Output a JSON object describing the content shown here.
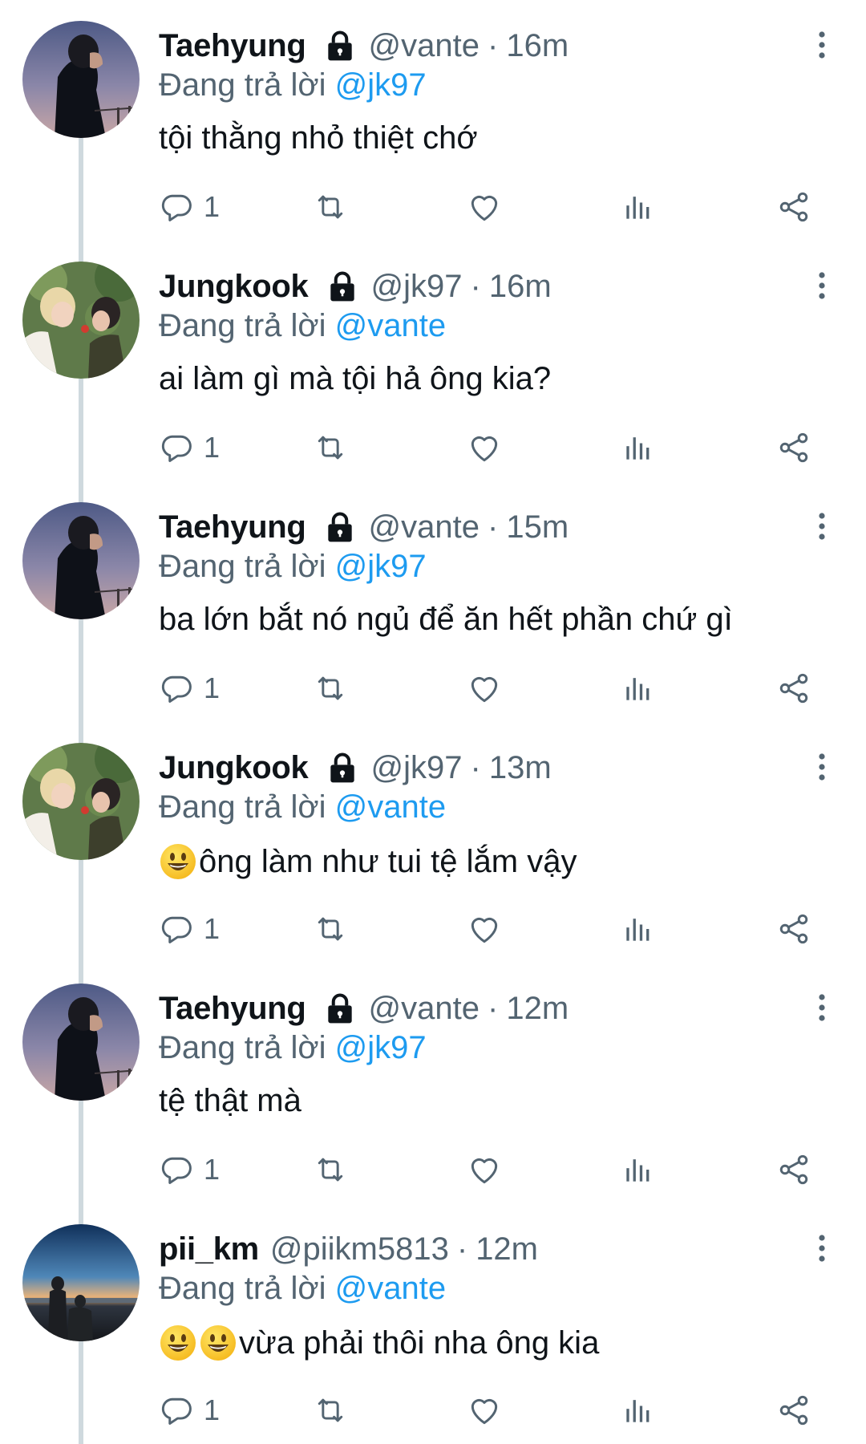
{
  "tweets": [
    {
      "name": "Taehyung",
      "protected": true,
      "handle": "@vante",
      "separator": "·",
      "time": "16m",
      "reply_prefix": "Đang trả lời ",
      "reply_to": "@jk97",
      "emoji_count": 0,
      "text": "tội thằng nhỏ thiệt chớ",
      "reply_count": "1",
      "avatar": "taehyung-avatar"
    },
    {
      "name": "Jungkook",
      "protected": true,
      "handle": "@jk97",
      "separator": "·",
      "time": "16m",
      "reply_prefix": "Đang trả lời ",
      "reply_to": "@vante",
      "emoji_count": 0,
      "text": "ai làm gì mà tội hả ông kia?",
      "reply_count": "1",
      "avatar": "jungkook-avatar"
    },
    {
      "name": "Taehyung",
      "protected": true,
      "handle": "@vante",
      "separator": "·",
      "time": "15m",
      "reply_prefix": "Đang trả lời ",
      "reply_to": "@jk97",
      "emoji_count": 0,
      "text": "ba lớn bắt nó ngủ để ăn hết phần chứ gì",
      "reply_count": "1",
      "avatar": "taehyung-avatar"
    },
    {
      "name": "Jungkook",
      "protected": true,
      "handle": "@jk97",
      "separator": "·",
      "time": "13m",
      "reply_prefix": "Đang trả lời ",
      "reply_to": "@vante",
      "emoji_count": 1,
      "text": "ông làm như tui tệ lắm vậy",
      "reply_count": "1",
      "avatar": "jungkook-avatar"
    },
    {
      "name": "Taehyung",
      "protected": true,
      "handle": "@vante",
      "separator": "·",
      "time": "12m",
      "reply_prefix": "Đang trả lời ",
      "reply_to": "@jk97",
      "emoji_count": 0,
      "text": "tệ thật mà",
      "reply_count": "1",
      "avatar": "taehyung-avatar"
    },
    {
      "name": "pii_km",
      "protected": false,
      "handle": "@piikm5813",
      "separator": "·",
      "time": "12m",
      "reply_prefix": "Đang trả lời ",
      "reply_to": "@vante",
      "emoji_count": 2,
      "text": "vừa phải thôi nha ông kia",
      "reply_count": "1",
      "avatar": "piikm-avatar"
    }
  ],
  "icons": {
    "reply": "reply-icon",
    "retweet": "retweet-icon",
    "like": "heart-icon",
    "views": "views-icon",
    "share": "share-icon",
    "more": "more-vertical-icon",
    "lock": "lock-icon",
    "emoji": "grinning-face-emoji"
  },
  "colors": {
    "text": "#0f1419",
    "secondary": "#536471",
    "mention": "#1d9bf0",
    "thread_line": "#cfd9de"
  }
}
